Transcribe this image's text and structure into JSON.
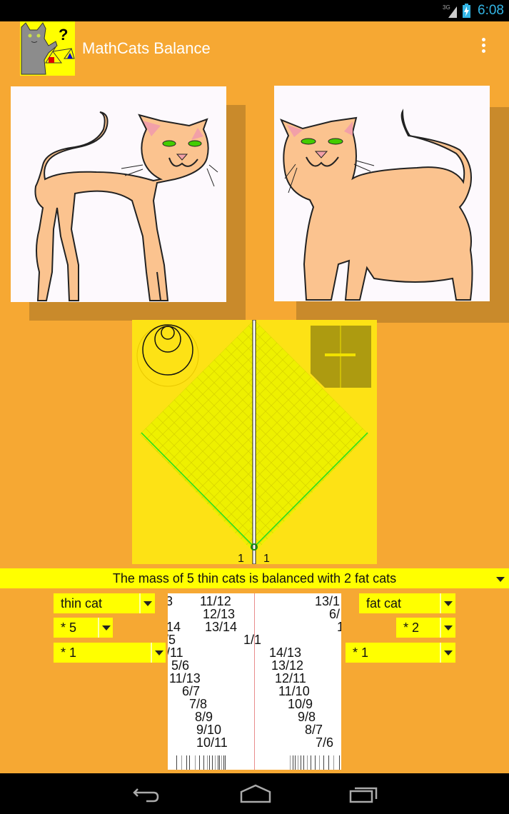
{
  "status_bar": {
    "network": "3G",
    "time": "6:08"
  },
  "action_bar": {
    "app_icon": "mathcats-balance-icon",
    "title": "MathCats Balance",
    "overflow_icon": "overflow-menu-icon"
  },
  "pictures": {
    "left": {
      "name": "thin cat"
    },
    "right": {
      "name": "fat cat"
    }
  },
  "balance": {
    "left_count_label": "1",
    "right_count_label": "1",
    "colors": {
      "background": "#fde215",
      "grid": "#eef000",
      "beam": "#22dd22"
    }
  },
  "sentence": {
    "text": "The mass of 5 thin cats is balanced with 2 fat cats"
  },
  "left_controls": {
    "object": "thin cat",
    "multiplier": "* 5",
    "scale": "* 1"
  },
  "right_controls": {
    "object": "fat cat",
    "multiplier": "* 2",
    "scale": "* 1"
  },
  "fraction_ruler": {
    "left": [
      "3",
      "11/12",
      "12/13",
      "14",
      "13/14",
      "/5",
      "/11",
      "5/6",
      "11/13",
      "6/7",
      "7/8",
      "8/9",
      "9/10",
      "10/11"
    ],
    "center": "1/1",
    "right": [
      "13/1",
      "6/",
      "1",
      "14/13",
      "13/12",
      "12/11",
      "11/10",
      "10/9",
      "9/8",
      "8/7",
      "7/6"
    ]
  },
  "nav_bar": {
    "back": "back-icon",
    "home": "home-icon",
    "recents": "recents-icon"
  }
}
